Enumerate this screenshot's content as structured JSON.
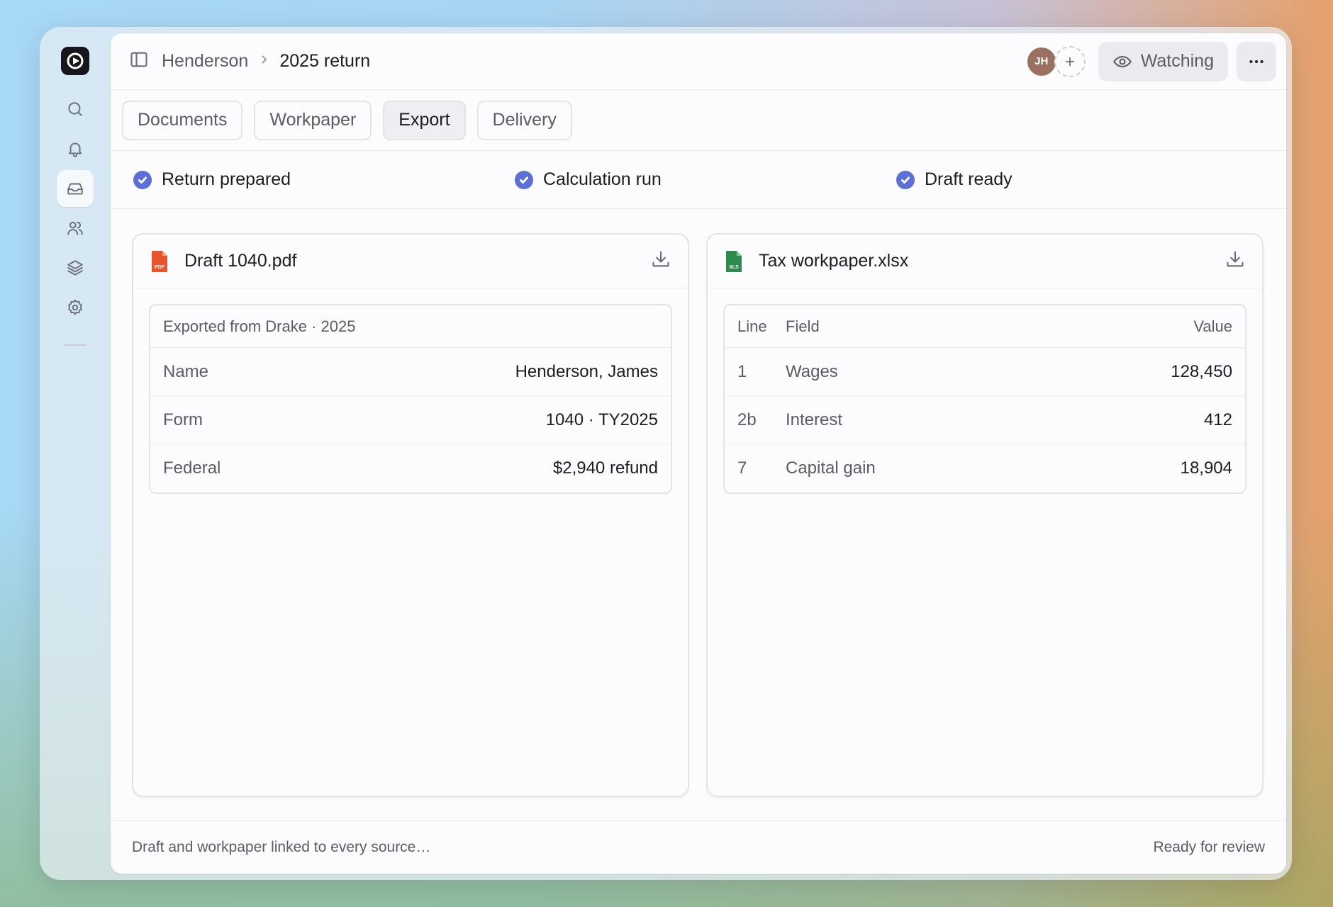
{
  "breadcrumb": {
    "parent": "Henderson",
    "current": "2025 return"
  },
  "avatar": {
    "initials": "JH"
  },
  "watch_button": {
    "label": "Watching"
  },
  "tabs": [
    {
      "label": "Documents",
      "active": false
    },
    {
      "label": "Workpaper",
      "active": false
    },
    {
      "label": "Export",
      "active": true
    },
    {
      "label": "Delivery",
      "active": false
    }
  ],
  "status": [
    {
      "label": "Return prepared"
    },
    {
      "label": "Calculation run"
    },
    {
      "label": "Draft ready"
    }
  ],
  "pdf_card": {
    "title": "Draft 1040.pdf",
    "icon_label": "PDF",
    "header": "Exported from Drake · 2025",
    "rows": [
      {
        "key": "Name",
        "value": "Henderson, James"
      },
      {
        "key": "Form",
        "value": "1040 · TY2025"
      },
      {
        "key": "Federal",
        "value": "$2,940 refund"
      }
    ]
  },
  "xlsx_card": {
    "title": "Tax workpaper.xlsx",
    "icon_label": "XLS",
    "columns": {
      "line": "Line",
      "field": "Field",
      "value": "Value"
    },
    "rows": [
      {
        "line": "1",
        "field": "Wages",
        "value": "128,450"
      },
      {
        "line": "2b",
        "field": "Interest",
        "value": "412"
      },
      {
        "line": "7",
        "field": "Capital gain",
        "value": "18,904"
      }
    ]
  },
  "footer": {
    "left": "Draft and workpaper linked to every source…",
    "right": "Ready for review"
  },
  "colors": {
    "accent": "#5b6fd6",
    "pdf": "#e8552d",
    "xlsx": "#2f8a4f"
  }
}
